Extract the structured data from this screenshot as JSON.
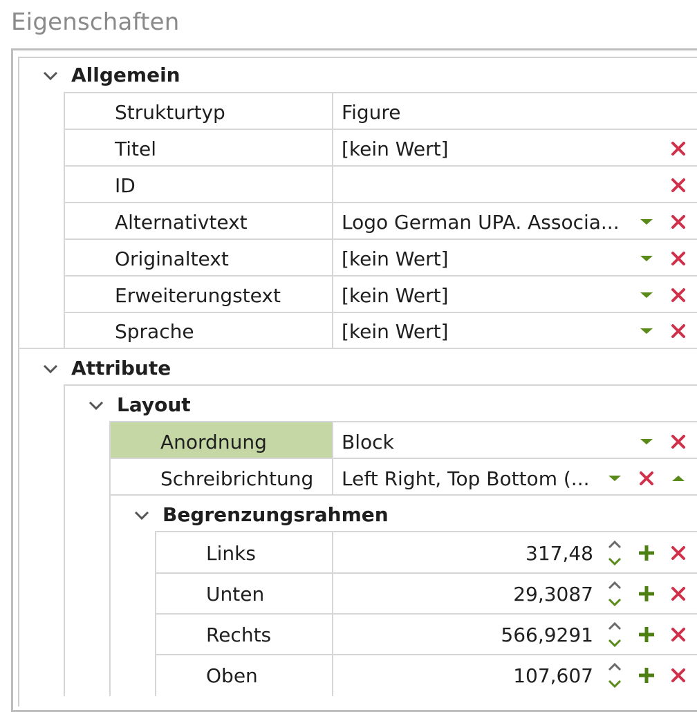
{
  "panel": {
    "title": "Eigenschaften"
  },
  "groups": {
    "allgemein": {
      "label": "Allgemein",
      "rows": [
        {
          "label": "Strukturtyp",
          "value": "Figure"
        },
        {
          "label": "Titel",
          "value": "[kein Wert]"
        },
        {
          "label": "ID",
          "value": ""
        },
        {
          "label": "Alternativtext",
          "value": "Logo German UPA. Associa..."
        },
        {
          "label": "Originaltext",
          "value": "[kein Wert]"
        },
        {
          "label": "Erweiterungstext",
          "value": "[kein Wert]"
        },
        {
          "label": "Sprache",
          "value": "[kein Wert]"
        }
      ]
    },
    "attribute": {
      "label": "Attribute",
      "layout": {
        "label": "Layout",
        "rows": [
          {
            "label": "Anordnung",
            "value": "Block",
            "selected": true
          },
          {
            "label": "Schreibrichtung",
            "value": "Left Right, Top Bottom (..."
          }
        ],
        "begrenzungsrahmen": {
          "label": "Begrenzungsrahmen",
          "rows": [
            {
              "label": "Links",
              "value": "317,48"
            },
            {
              "label": "Unten",
              "value": "29,3087"
            },
            {
              "label": "Rechts",
              "value": "566,9291"
            },
            {
              "label": "Oben",
              "value": "107,607"
            }
          ]
        }
      }
    }
  },
  "icons": {
    "collapse": "chevron-down-icon",
    "dropdown": "triangle-down-icon",
    "remove": "close-x-icon",
    "add": "plus-icon",
    "spin": "spin-up-down-icon",
    "collapse_up": "triangle-up-icon"
  },
  "colors": {
    "remove": "#d0304a",
    "green": "#5a8a1a",
    "selected_bg": "#c5d7a5",
    "border": "#d6d6d6",
    "title": "#8a8a8a"
  }
}
